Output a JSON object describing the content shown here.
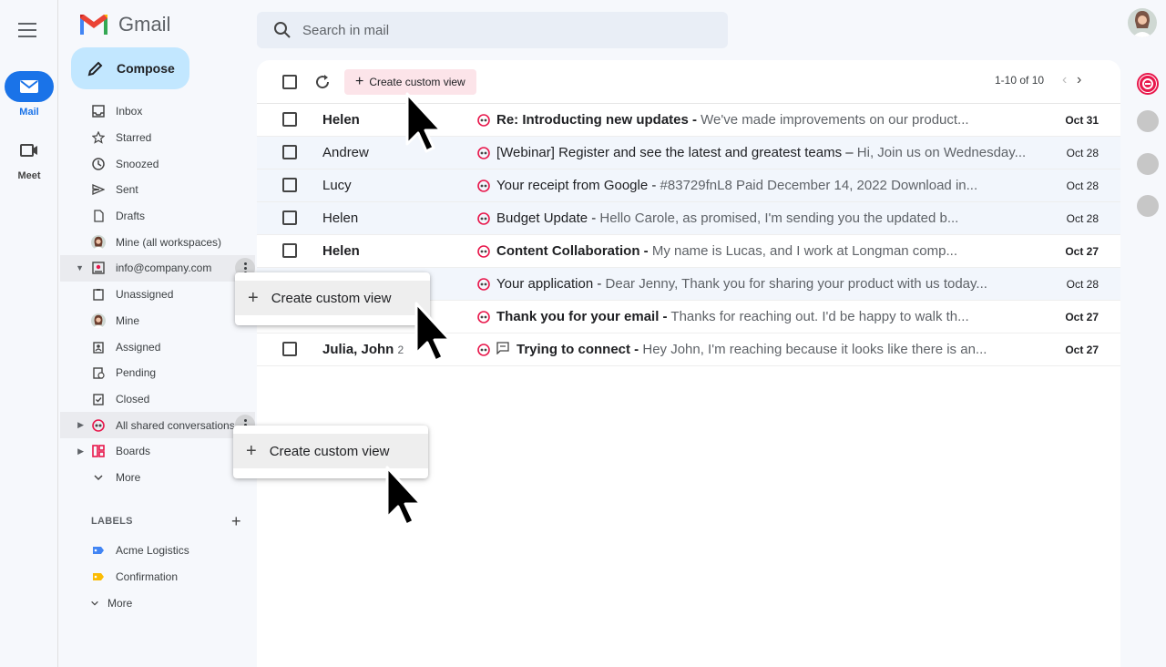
{
  "rail": {
    "mail_label": "Mail",
    "meet_label": "Meet"
  },
  "app": {
    "name": "Gmail"
  },
  "compose": {
    "label": "Compose"
  },
  "search": {
    "placeholder": "Search in mail"
  },
  "nav": {
    "items": [
      {
        "label": "Inbox",
        "icon": "inbox-icon"
      },
      {
        "label": "Starred",
        "icon": "star-icon"
      },
      {
        "label": "Snoozed",
        "icon": "clock-icon"
      },
      {
        "label": "Sent",
        "icon": "send-icon"
      },
      {
        "label": "Drafts",
        "icon": "draft-icon"
      },
      {
        "label": "Mine (all workspaces)",
        "icon": "avatar-icon"
      },
      {
        "label": "info@company.com",
        "icon": "shared-inbox-icon"
      },
      {
        "label": "Unassigned",
        "icon": "clipboard-icon"
      },
      {
        "label": "Mine",
        "icon": "avatar-icon"
      },
      {
        "label": "Assigned",
        "icon": "assigned-icon"
      },
      {
        "label": "Pending",
        "icon": "pending-icon"
      },
      {
        "label": "Closed",
        "icon": "closed-icon"
      },
      {
        "label": "All shared conversations",
        "icon": "shared-conversations-icon"
      },
      {
        "label": "Boards",
        "icon": "boards-icon"
      },
      {
        "label": "More",
        "icon": "chevron-down-icon"
      }
    ]
  },
  "labels": {
    "heading": "LABELS",
    "items": [
      {
        "label": "Acme Logistics",
        "color": "#4285f4"
      },
      {
        "label": "Confirmation",
        "color": "#fbbc04"
      },
      {
        "label": "More",
        "color": ""
      }
    ]
  },
  "toolbar": {
    "create_view_label": "Create custom view",
    "pager": "1-10 of 10"
  },
  "emails": [
    {
      "sender": "Helen",
      "count": "",
      "subject": "Re: Introducting new updates -",
      "snippet": " We've made improvements on our product...",
      "date": "Oct 31",
      "unread": true
    },
    {
      "sender": "Andrew",
      "count": "",
      "subject": "[Webinar] Register and see the latest and greatest teams –",
      "snippet": " Hi, Join us on Wednesday...",
      "date": "Oct 28",
      "unread": false
    },
    {
      "sender": "Lucy",
      "count": "",
      "subject": "Your receipt from Google -",
      "snippet": " #83729fnL8 Paid December 14, 2022 Download in...",
      "date": "Oct 28",
      "unread": false
    },
    {
      "sender": "Helen",
      "count": "",
      "subject": "Budget Update -",
      "snippet": " Hello Carole, as promised, I'm sending you the updated b...",
      "date": "Oct 28",
      "unread": false
    },
    {
      "sender": "Helen",
      "count": "",
      "subject": "Content Collaboration -",
      "snippet": " My name is  Lucas, and I work at Longman comp...",
      "date": "Oct 27",
      "unread": true
    },
    {
      "sender": "",
      "count": "",
      "subject": "Your application -",
      "snippet": " Dear Jenny, Thank you for sharing your product with us today...",
      "date": "Oct 28",
      "unread": false
    },
    {
      "sender": "",
      "count": "",
      "subject": "Thank you for your email -",
      "snippet": " Thanks for reaching out. I'd be happy to walk th...",
      "date": "Oct 27",
      "unread": true
    },
    {
      "sender": "Julia, John",
      "count": "2",
      "subject": "Trying to connect -",
      "snippet": " Hey John, I'm reaching because it looks like there is an...",
      "date": "Oct 27",
      "unread": true
    }
  ],
  "popups": [
    {
      "label": "Create custom view"
    },
    {
      "label": "Create custom view"
    }
  ],
  "colors": {
    "accent": "#1a73e8",
    "compose_bg": "#c2e7ff",
    "brand_red": "#e8174b"
  }
}
